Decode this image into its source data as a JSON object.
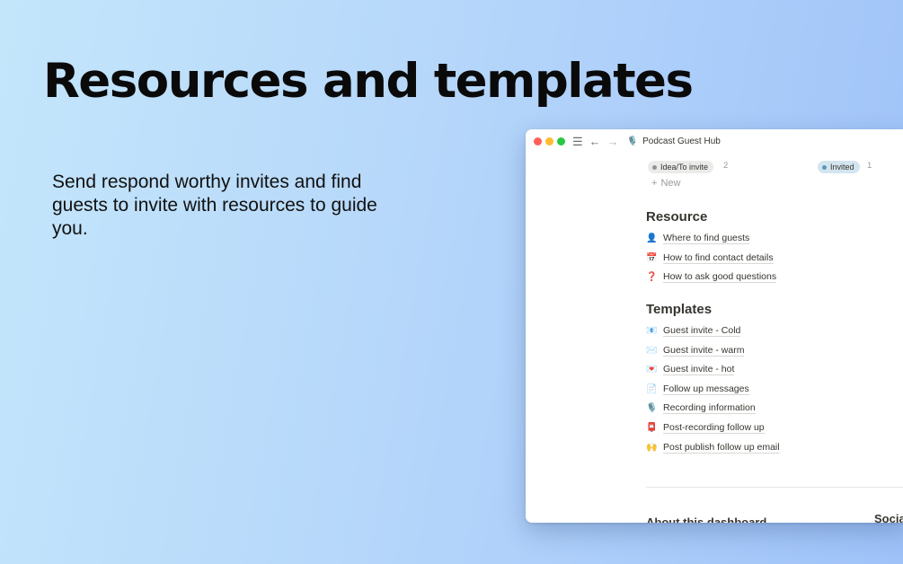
{
  "headline": "Resources and templates",
  "subtext": "Send respond worthy invites and find guests to invite with resources to guide you.",
  "window": {
    "title": "Podcast Guest Hub",
    "page_icon": "🎙️",
    "statuses": [
      {
        "label": "Idea/To invite",
        "count": "2",
        "dot_color": "#91918e"
      },
      {
        "label": "Invited",
        "count": "1",
        "dot_color": "#5b97bd"
      }
    ],
    "new_label": "New",
    "resource": {
      "heading": "Resource",
      "items": [
        {
          "icon": "👤",
          "label": "Where to find guests"
        },
        {
          "icon": "📅",
          "label": "How to find contact details"
        },
        {
          "icon": "❓",
          "label": "How to ask good questions"
        }
      ]
    },
    "templates": {
      "heading": "Templates",
      "items": [
        {
          "icon": "📧",
          "label": "Guest invite - Cold"
        },
        {
          "icon": "✉️",
          "label": "Guest invite - warm"
        },
        {
          "icon": "💌",
          "label": "Guest invite - hot"
        },
        {
          "icon": "📄",
          "label": "Follow up messages"
        },
        {
          "icon": "🎙️",
          "label": "Recording information"
        },
        {
          "icon": "📮",
          "label": "Post-recording follow up"
        },
        {
          "icon": "🙌",
          "label": "Post publish follow up email"
        }
      ]
    },
    "about_heading": "About this dashboard",
    "social_heading": "Social"
  },
  "colors": {
    "traffic_red": "#ff5f57",
    "traffic_yellow": "#febc2e",
    "traffic_green": "#28c840",
    "invited_tag_bg": "#d3e5ef",
    "idea_tag_bg": "#ebebea"
  }
}
